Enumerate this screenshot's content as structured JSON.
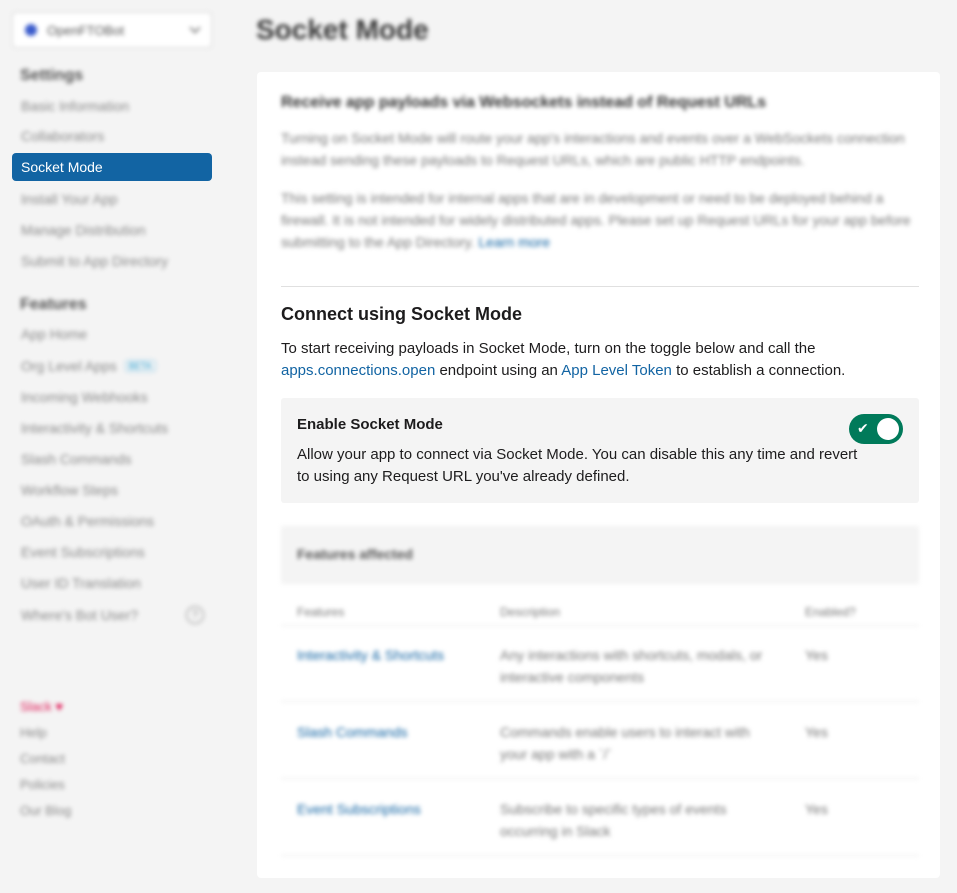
{
  "sidebar": {
    "app_name": "OpenFTOBot",
    "settings_title": "Settings",
    "settings_items": [
      {
        "label": "Basic Information"
      },
      {
        "label": "Collaborators"
      },
      {
        "label": "Socket Mode"
      },
      {
        "label": "Install Your App"
      },
      {
        "label": "Manage Distribution"
      },
      {
        "label": "Submit to App Directory"
      }
    ],
    "features_title": "Features",
    "feature_items": [
      {
        "label": "App Home"
      },
      {
        "label": "Org Level Apps",
        "badge": "BETA"
      },
      {
        "label": "Incoming Webhooks"
      },
      {
        "label": "Interactivity & Shortcuts"
      },
      {
        "label": "Slash Commands"
      },
      {
        "label": "Workflow Steps"
      },
      {
        "label": "OAuth & Permissions"
      },
      {
        "label": "Event Subscriptions"
      },
      {
        "label": "User ID Translation"
      },
      {
        "label": "Where's Bot User?",
        "help": "?"
      }
    ],
    "footer": {
      "slack": "Slack ♥",
      "help": "Help",
      "contact": "Contact",
      "policies": "Policies",
      "blog": "Our Blog"
    }
  },
  "main": {
    "page_title": "Socket Mode",
    "intro_heading": "Receive app payloads via Websockets instead of Request URLs",
    "intro_para1": "Turning on Socket Mode will route your app's interactions and events over a WebSockets connection instead sending these payloads to Request URLs, which are public HTTP endpoints.",
    "intro_para2": "This setting is intended for internal apps that are in development or need to be deployed behind a firewall. It is not intended for widely distributed apps. Please set up Request URLs for your app before submitting to the App Directory.",
    "learn_more": "Learn more",
    "connect_heading": "Connect using Socket Mode",
    "connect_text_1": "To start receiving payloads in Socket Mode, turn on the toggle below and call the",
    "connect_link_1": "apps.connections.open",
    "connect_text_2": "endpoint using an",
    "connect_link_2": "App Level Token",
    "connect_text_3": "to establish a connection.",
    "toggle": {
      "title": "Enable Socket Mode",
      "description": "Allow your app to connect via Socket Mode. You can disable this any time and revert to using any Request URL you've already defined.",
      "state": "on",
      "check": "✔",
      "color": "#007a5a"
    },
    "features_affected": "Features affected",
    "columns": [
      "Features",
      "Description",
      "Enabled?"
    ],
    "rows": [
      {
        "feature": "Interactivity & Shortcuts",
        "description": "Any interactions with shortcuts, modals, or interactive components",
        "enabled": "Yes"
      },
      {
        "feature": "Slash Commands",
        "description": "Commands enable users to interact with your app with a `/`",
        "enabled": "Yes"
      },
      {
        "feature": "Event Subscriptions",
        "description": "Subscribe to specific types of events occurring in Slack",
        "enabled": "Yes"
      }
    ]
  }
}
